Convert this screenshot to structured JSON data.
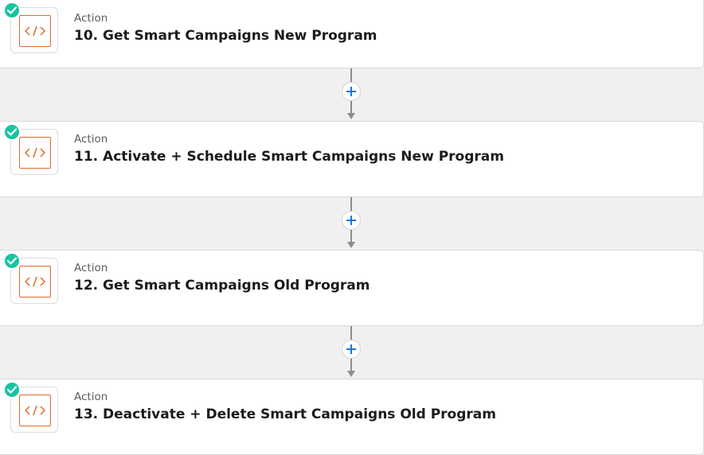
{
  "steps": [
    {
      "type": "Action",
      "title": "10. Get Smart Campaigns New Program",
      "app_icon": "code-icon",
      "status_icon": "check-icon"
    },
    {
      "type": "Action",
      "title": "11. Activate + Schedule Smart Campaigns New Program",
      "app_icon": "code-icon",
      "status_icon": "check-icon"
    },
    {
      "type": "Action",
      "title": "12. Get Smart Campaigns Old Program",
      "app_icon": "code-icon",
      "status_icon": "check-icon"
    },
    {
      "type": "Action",
      "title": "13. Deactivate + Delete Smart Campaigns Old Program",
      "app_icon": "code-icon",
      "status_icon": "check-icon"
    }
  ],
  "connectors": [
    {
      "icon": "plus-icon"
    },
    {
      "icon": "plus-icon"
    },
    {
      "icon": "plus-icon"
    }
  ],
  "colors": {
    "canvas_background": "#f0f0f0",
    "card_background": "#ffffff",
    "success_badge": "#17c3a2",
    "code_icon_accent": "#e06a28",
    "add_button_accent": "#1a73e8",
    "connector_line": "#8c8c8c"
  }
}
